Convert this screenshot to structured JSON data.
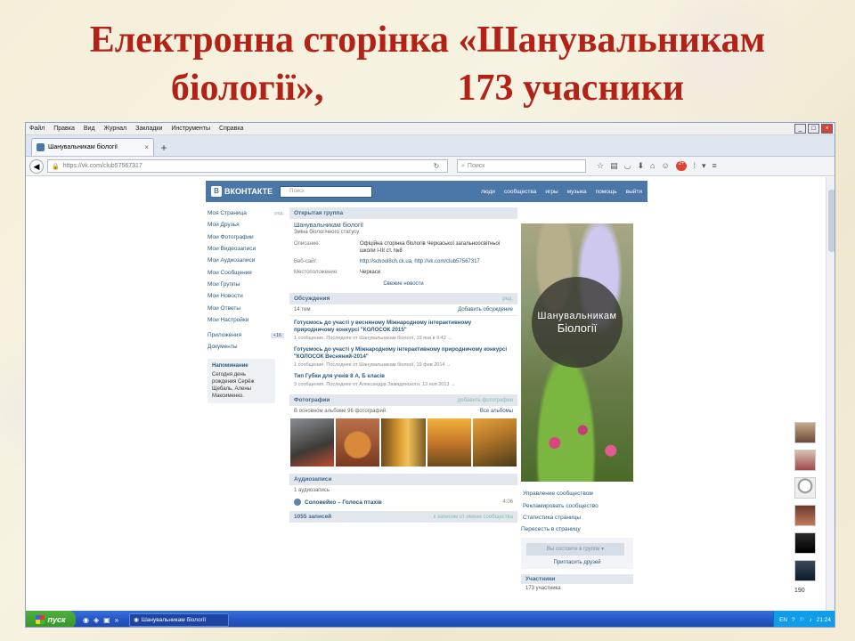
{
  "slide": {
    "title_line1": "Електронна сторінка «Шанувальникам",
    "title_line2a": "біології»,",
    "title_line2b": "173 учасники"
  },
  "browser": {
    "menu": [
      "Файл",
      "Правка",
      "Вид",
      "Журнал",
      "Закладки",
      "Инструменты",
      "Справка"
    ],
    "tab_title": "Шанувальникам біології",
    "url": "https://vk.com/club57567317",
    "search_placeholder": "Поиск",
    "badge": "2+"
  },
  "vk": {
    "logo": "ВКОНТАКТЕ",
    "search_placeholder": "Поиск",
    "top_menu": [
      "люди",
      "сообщества",
      "игры",
      "музыка",
      "помощь",
      "выйти"
    ],
    "left_menu": [
      {
        "label": "Моя Страница",
        "edit": "ред."
      },
      {
        "label": "Мои Друзья"
      },
      {
        "label": "Мои Фотографии"
      },
      {
        "label": "Мои Видеозаписи"
      },
      {
        "label": "Мои Аудиозаписи"
      },
      {
        "label": "Мои Сообщения"
      },
      {
        "label": "Мои Группы"
      },
      {
        "label": "Мои Новости"
      },
      {
        "label": "Мои Ответы"
      },
      {
        "label": "Мои Настройки"
      }
    ],
    "apps": {
      "label": "Приложения",
      "badge": "+16"
    },
    "docs": "Документы",
    "reminder": {
      "title": "Напоминание",
      "text": "Сегодня день рождения Серёж Щебаль, Алены Максименко."
    },
    "group_type": "Открытая группа",
    "group_name": "Шанувальникам біології",
    "group_status": "Зміна біологічного статусу",
    "info": [
      {
        "k": "Описание:",
        "v": "Офіційна сторінка біологів Черкаської загальноосвітньої школи І-ІІІ ст. №8",
        "link": false
      },
      {
        "k": "Веб-сайт:",
        "v": "http://school8ch.ck.ua, http://vk.com/club57567317",
        "link": true
      },
      {
        "k": "Местоположение:",
        "v": "Черкаси",
        "link": false
      }
    ],
    "news_link": "Свежие новости",
    "discussions": {
      "title": "Обсуждения",
      "edit": "ред.",
      "count": "14 тем",
      "add": "Добавить обсуждение"
    },
    "topics": [
      {
        "t": "Готуємось до участі у весняному Міжнародному інтерактивному природничому конкурсі \"КОЛОСОК 2015\"",
        "m": "1 сообщение. Последнее от Шанувальникам біології, 19 янв в 9:42 →"
      },
      {
        "t": "Готуємось до участі у Міжнародному інтерактивному природничому конкурсі \"КОЛОСОК Весняний-2014\"",
        "m": "1 сообщение. Последнее от Шанувальникам біології, 19 фев 2014 →"
      },
      {
        "t": "Тип Губки для учнів 8 А, Б класів",
        "m": "3 сообщения. Последнее от Александра Замадянского, 13 ноя 2013 →"
      }
    ],
    "photos": {
      "title": "Фотографии",
      "add": "добавить фотографии",
      "count": "В основном альбоме 96 фотографий",
      "all": "Все альбомы"
    },
    "audio": {
      "title": "Аудиозаписи",
      "count": "1 аудиозапись",
      "track": "Соловейко – Голоса птахів",
      "duration": "4:06"
    },
    "wall": {
      "title": "1055 записей",
      "right": "к записям от имени сообщества"
    },
    "avatar_text_1": "Шанувальникам",
    "avatar_text_2": "Біології",
    "manage": [
      "Управление сообществом",
      "Рекламировать сообщество",
      "Статистика страницы"
    ],
    "stat": "Пересесть в страницу",
    "join": "Вы состоите в группе ▾",
    "invite": "Пригласить друзей",
    "members_title": "Участники",
    "members_count": "173 участника",
    "side_count": "190"
  },
  "taskbar": {
    "start": "пуск",
    "task": "Шанувальникам біології",
    "lang": "EN",
    "clock": "21:24"
  }
}
